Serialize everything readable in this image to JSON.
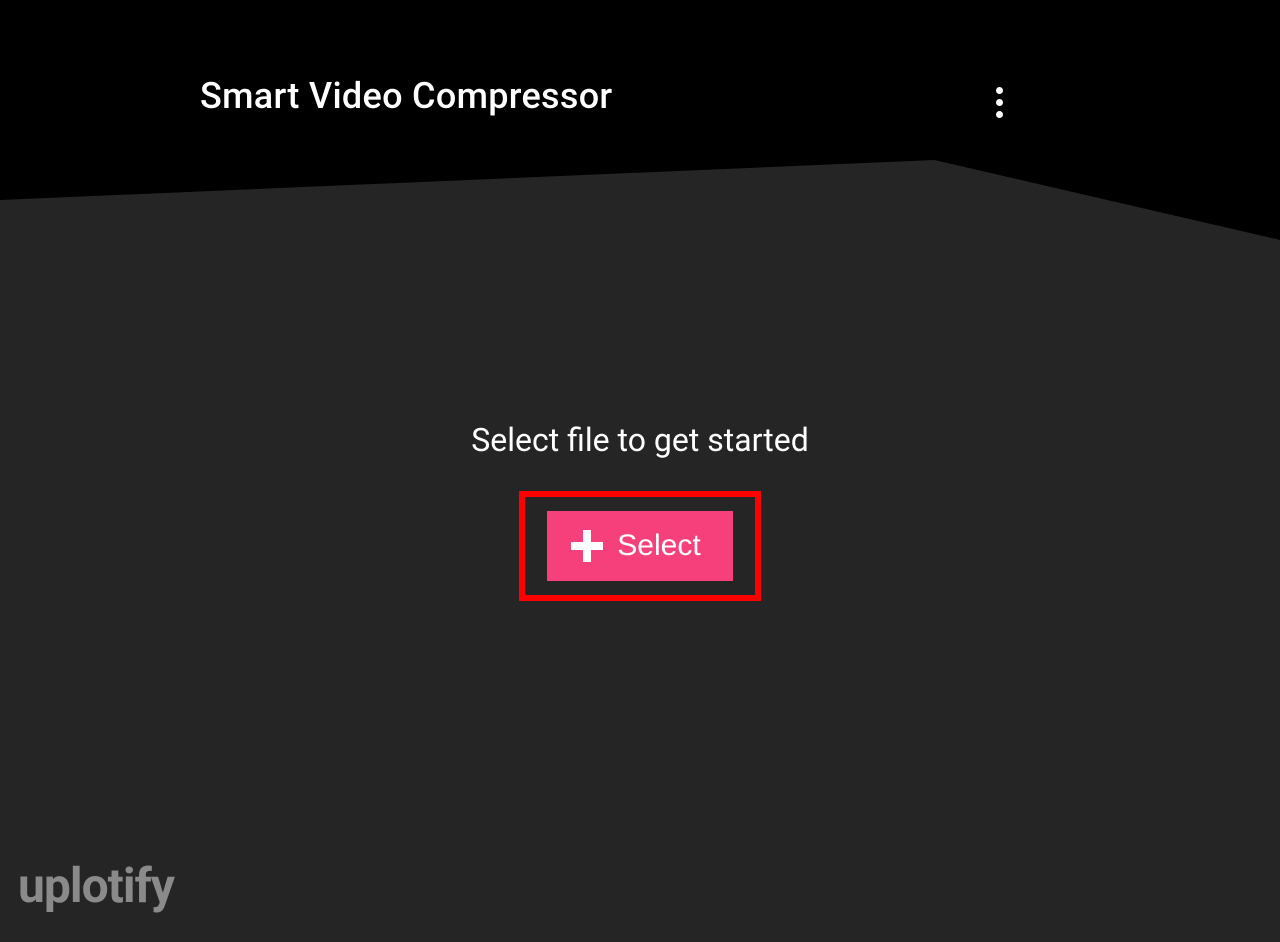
{
  "header": {
    "title": "Smart Video Compressor"
  },
  "content": {
    "prompt": "Select file to get started",
    "select_button_label": "Select"
  },
  "watermark": "uplotify"
}
